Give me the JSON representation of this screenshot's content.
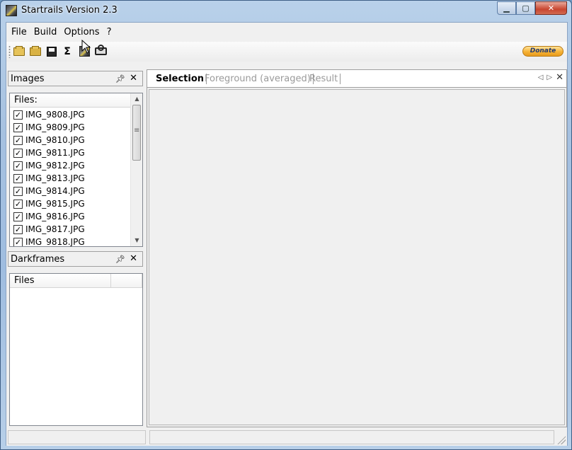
{
  "window": {
    "title": "Startrails Version 2.3"
  },
  "menu": [
    "File",
    "Build",
    "Options",
    "?"
  ],
  "toolbar": {
    "buttons": [
      "open-images-icon",
      "open-darkframes-icon",
      "save-icon",
      "sigma-icon",
      "startrails-icon",
      "video-camera-icon"
    ],
    "donate_label": "Donate"
  },
  "images_panel": {
    "title": "Images",
    "column_header": "Files:",
    "files": [
      {
        "name": "IMG_9808.JPG",
        "checked": true
      },
      {
        "name": "IMG_9809.JPG",
        "checked": true
      },
      {
        "name": "IMG_9810.JPG",
        "checked": true
      },
      {
        "name": "IMG_9811.JPG",
        "checked": true
      },
      {
        "name": "IMG_9812.JPG",
        "checked": true
      },
      {
        "name": "IMG_9813.JPG",
        "checked": true
      },
      {
        "name": "IMG_9814.JPG",
        "checked": true
      },
      {
        "name": "IMG_9815.JPG",
        "checked": true
      },
      {
        "name": "IMG_9816.JPG",
        "checked": true
      },
      {
        "name": "IMG_9817.JPG",
        "checked": true
      },
      {
        "name": "IMG_9818.JPG",
        "checked": true
      }
    ]
  },
  "darkframes_panel": {
    "title": "Darkframes",
    "column_header": "Files"
  },
  "tabs": [
    {
      "label": "Selection",
      "active": true
    },
    {
      "label": "Foreground (averaged)",
      "active": false
    },
    {
      "label": "Result",
      "active": false
    }
  ]
}
